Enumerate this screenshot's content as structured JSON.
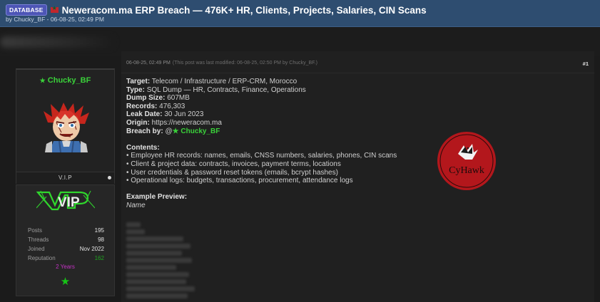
{
  "header": {
    "badge": "DATABASE",
    "title": "Neweracom.ma ERP Breach — 476K+ HR, Clients, Projects, Salaries, CIN Scans",
    "byline": "by Chucky_BF - 06-08-25, 02:49 PM"
  },
  "profile": {
    "username": "Chucky_BF",
    "rank": "V.I.P",
    "vip_logo": "VIP",
    "stats": [
      {
        "label": "Posts",
        "value": "195"
      },
      {
        "label": "Threads",
        "value": "98"
      },
      {
        "label": "Joined",
        "value": "Nov 2022"
      },
      {
        "label": "Reputation",
        "value": "162"
      }
    ],
    "tenure": "2 Years"
  },
  "post": {
    "date": "06-08-25, 02:49 PM",
    "modified": "(This post was last modified: 06-08-25, 02:50 PM by Chucky_BF.)",
    "number": "#1",
    "fields": [
      {
        "label": "Target:",
        "value": "Telecom / Infrastructure / ERP-CRM, Morocco"
      },
      {
        "label": "Type:",
        "value": "SQL Dump — HR, Contracts, Finance, Operations"
      },
      {
        "label": "Dump Size:",
        "value": "607MB"
      },
      {
        "label": "Records:",
        "value": "476,303"
      },
      {
        "label": "Leak Date:",
        "value": "30 Jun 2023"
      },
      {
        "label": "Origin:",
        "value": "https://neweracom.ma"
      }
    ],
    "breach_by_label": "Breach by:",
    "breach_by_prefix": "@",
    "breach_by_user": "Chucky_BF",
    "contents_heading": "Contents:",
    "contents": [
      "• Employee HR records: names, emails, CNSS numbers, salaries, phones, CIN scans",
      "• Client & project data: contracts, invoices, payment terms, locations",
      "• User credentials & password reset tokens (emails, bcrypt hashes)",
      "• Operational logs: budgets, transactions, procurement, attendance logs"
    ],
    "preview_heading": "Example Preview:",
    "preview_name": "Name",
    "logo_text": "CyHawk"
  },
  "colors": {
    "header_bg": "#2e4d70",
    "badge_bg": "#4d55b6",
    "username_green": "#3ad13a",
    "tenure_purple": "#c432c4",
    "logo_red": "#b3171c"
  },
  "icons": [
    "star-icon",
    "flag-morocco-icon",
    "online-dot-icon",
    "hawk-icon"
  ]
}
